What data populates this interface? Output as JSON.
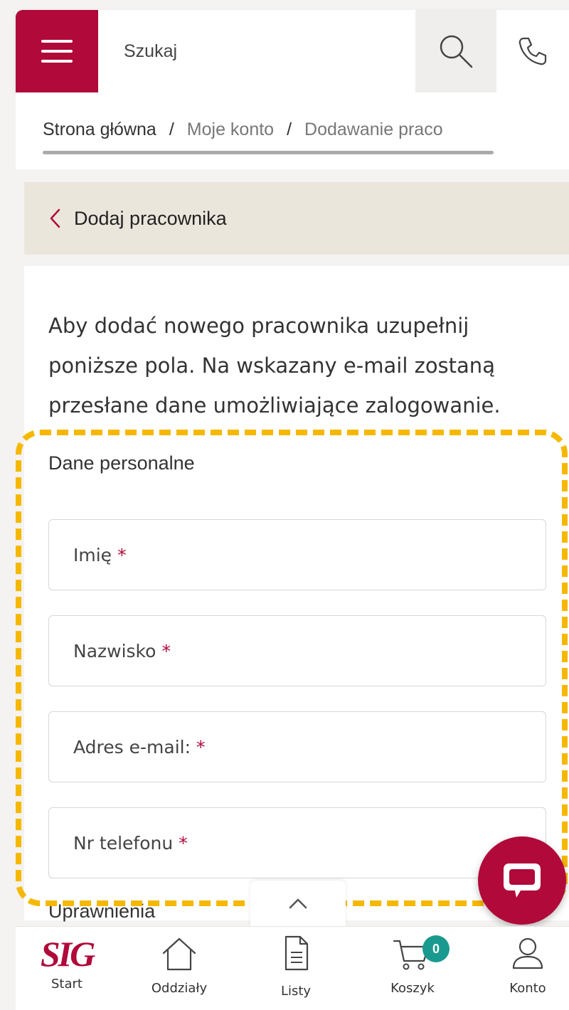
{
  "header": {
    "search_placeholder": "Szukaj"
  },
  "breadcrumb": {
    "items": [
      "Strona główna",
      "Moje konto",
      "Dodawanie praco"
    ],
    "separator": "/"
  },
  "page": {
    "back_title": "Dodaj pracownika",
    "intro": "Aby dodać nowego pracownika uzupełnij poniższe pola. Na wskazany e-mail zostaną przesłane dane umożliwiające zalogowanie.",
    "section_personal": "Dane personalne",
    "section_permissions": "Uprawnienia"
  },
  "form": {
    "fields": [
      {
        "label": "Imię",
        "required": "*"
      },
      {
        "label": "Nazwisko",
        "required": "*"
      },
      {
        "label": "Adres e-mail:",
        "required": "*"
      },
      {
        "label": "Nr telefonu",
        "required": "*"
      }
    ]
  },
  "bottom_nav": {
    "items": [
      {
        "label": "Start",
        "icon": "sig-logo",
        "logo_text": "SIG"
      },
      {
        "label": "Oddziały",
        "icon": "home-icon"
      },
      {
        "label": "Listy",
        "icon": "document-icon"
      },
      {
        "label": "Koszyk",
        "icon": "cart-icon",
        "badge": "0"
      },
      {
        "label": "Konto",
        "icon": "user-icon"
      }
    ]
  },
  "colors": {
    "brand": "#b0093a",
    "badge": "#1a9a8f",
    "highlight": "#f5b800",
    "back_bar": "#ebe6dc"
  }
}
